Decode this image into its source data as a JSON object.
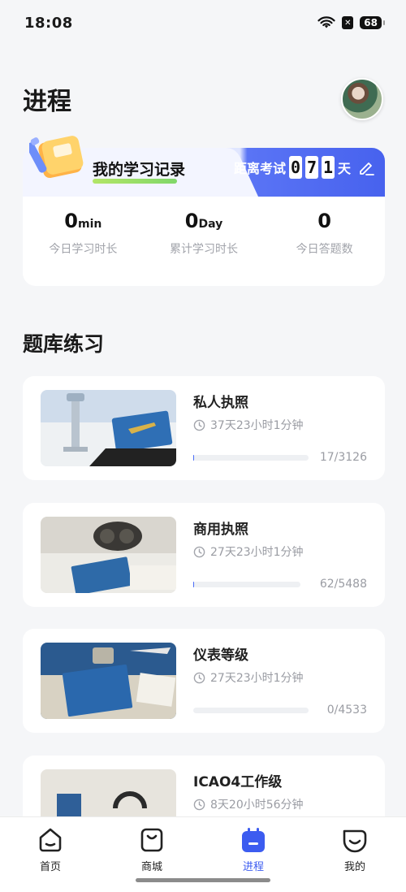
{
  "status": {
    "time": "18:08",
    "battery": "68"
  },
  "page": {
    "title": "进程"
  },
  "record": {
    "label": "我的学习记录",
    "exam_label": "距离考试",
    "days_digits": [
      "0",
      "7",
      "1"
    ],
    "days_unit": "天",
    "stats": [
      {
        "value": "0",
        "unit": "min",
        "label": "今日学习时长"
      },
      {
        "value": "0",
        "unit": "Day",
        "label": "累计学习时长"
      },
      {
        "value": "0",
        "unit": "",
        "label": "今日答题数"
      }
    ]
  },
  "bank": {
    "title": "题库练习",
    "courses": [
      {
        "name": "私人执照",
        "time": "37天23小时1分钟",
        "count": "17/3126",
        "progress": 0.005
      },
      {
        "name": "商用执照",
        "time": "27天23小时1分钟",
        "count": "62/5488",
        "progress": 0.011
      },
      {
        "name": "仪表等级",
        "time": "27天23小时1分钟",
        "count": "0/4533",
        "progress": 0
      },
      {
        "name": "ICAO4工作级",
        "time": "8天20小时56分钟",
        "count": "",
        "progress": 0
      }
    ]
  },
  "tabs": [
    {
      "label": "首页",
      "icon": "home-icon"
    },
    {
      "label": "商城",
      "icon": "shopping-bag-icon"
    },
    {
      "label": "进程",
      "icon": "calendar-icon"
    },
    {
      "label": "我的",
      "icon": "profile-smile-icon"
    }
  ],
  "colors": {
    "accent": "#3c5cf0",
    "banner_blue": "#4762ee"
  }
}
